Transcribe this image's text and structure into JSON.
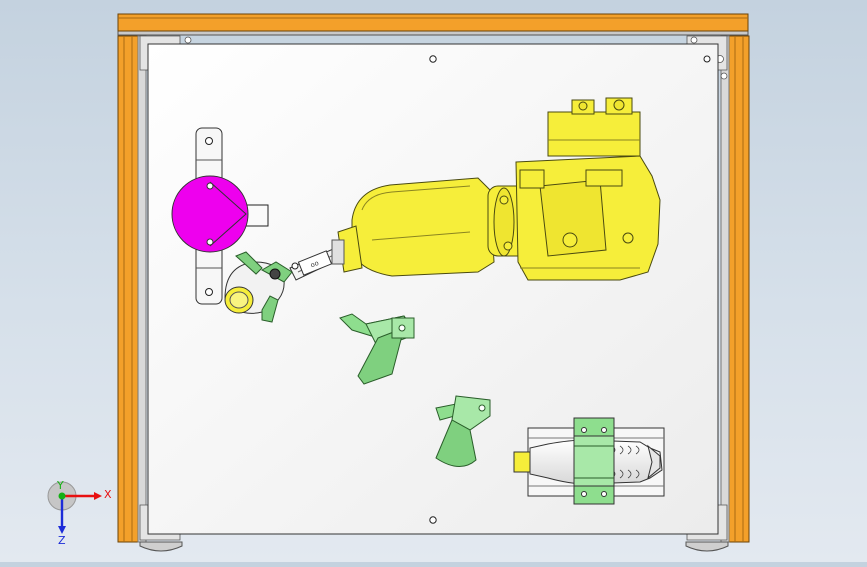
{
  "viewport": {
    "colors": {
      "frame": "#f3a02a",
      "frame_edge": "#6b4206",
      "plate": "#f4f4f4",
      "robot": "#f6ee3a",
      "magenta_part": "#ee00ee",
      "green_bracket": "#8ede8e",
      "bottle_body": "#f0f0f0",
      "bottle_cap": "#f6ee3a"
    },
    "components": [
      "frame",
      "base-plate",
      "robot-arm",
      "gripper",
      "magenta-fixture",
      "green-bracket",
      "bottle-fixture"
    ]
  },
  "triad": {
    "x_label": "X",
    "y_label": "Y",
    "z_label": "Z",
    "colors": {
      "x": "#e81010",
      "y": "#14b014",
      "z": "#1c2cd8"
    }
  }
}
